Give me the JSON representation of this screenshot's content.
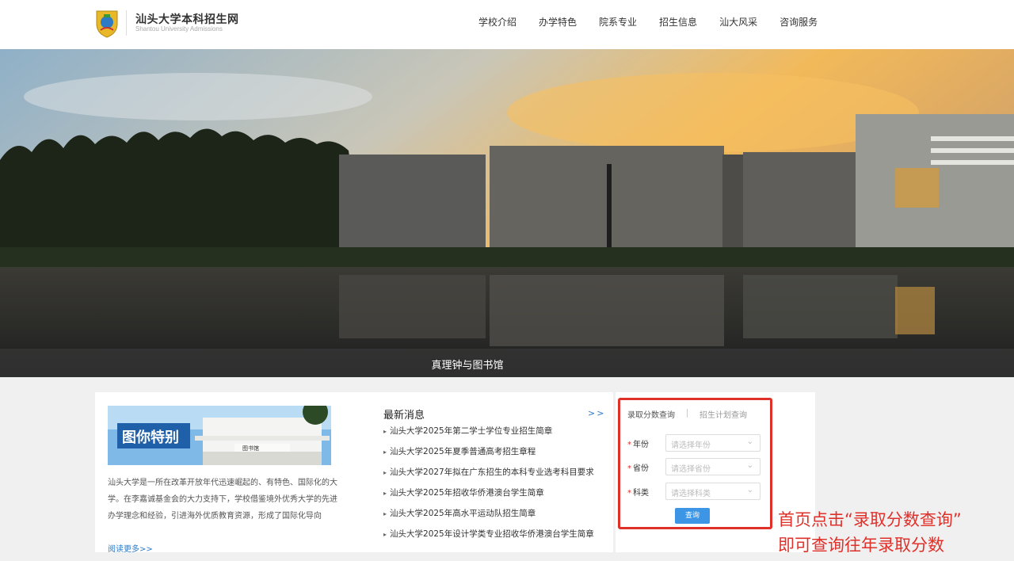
{
  "header": {
    "brand_title": "汕头大学本科招生网",
    "brand_subtitle": "Shantou University Admissions",
    "nav": [
      "学校介绍",
      "办学特色",
      "院系专业",
      "招生信息",
      "汕大风采",
      "咨询服务"
    ]
  },
  "banner": {
    "caption": "真理钟与图书馆"
  },
  "about": {
    "image_text": "图你特别",
    "building_sign": "图书馆",
    "text": "汕头大学是一所在改革开放年代迅速崛起的、有特色、国际化的大学。在李嘉诚基金会的大力支持下，学校借鉴境外优秀大学的先进办学理念和经验，引进海外优质教育资源，形成了国际化导向",
    "read_more": "阅读更多>>"
  },
  "news": {
    "title": "最新消息",
    "more": ">>",
    "items": [
      "汕头大学2025年第二学士学位专业招生简章",
      "汕头大学2025年夏季普通高考招生章程",
      "汕头大学2027年拟在广东招生的本科专业选考科目要求",
      "汕头大学2025年招收华侨港澳台学生简章",
      "汕头大学2025年高水平运动队招生简章",
      "汕头大学2025年设计学类专业招收华侨港澳台学生简章"
    ]
  },
  "query": {
    "tab_active": "录取分数查询",
    "tab_inactive": "招生计划查询",
    "fields": [
      {
        "label": "年份",
        "placeholder": "请选择年份"
      },
      {
        "label": "省份",
        "placeholder": "请选择省份"
      },
      {
        "label": "科类",
        "placeholder": "请选择科类"
      }
    ],
    "required_mark": "*",
    "submit": "查询"
  },
  "annotation": {
    "line1": "首页点击“录取分数查询”",
    "line2": "即可查询往年录取分数"
  },
  "colors": {
    "accent_blue": "#3d95e6",
    "annotation_red": "#e0302a"
  }
}
